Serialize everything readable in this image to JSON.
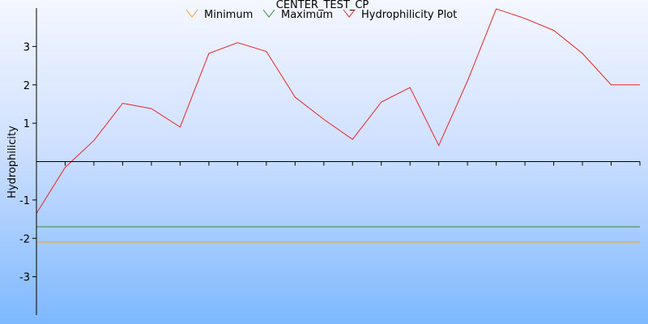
{
  "chart_data": {
    "type": "line",
    "title": "CENTER_TEST_CP",
    "xlabel": "",
    "ylabel": "Hydrophilicity",
    "ylim": [
      -4,
      4
    ],
    "yticks": [
      -3,
      -2,
      -1,
      1,
      2,
      3
    ],
    "x": [
      1,
      2,
      3,
      4,
      5,
      6,
      7,
      8,
      9,
      10,
      11,
      12,
      13,
      14,
      15,
      16,
      17,
      18,
      19,
      20,
      21,
      22
    ],
    "xlim": [
      1,
      22
    ],
    "grid": false,
    "legend_position": "top",
    "series": [
      {
        "name": "Minimum",
        "color": "#f0a030",
        "values": [
          -2.1,
          -2.1,
          -2.1,
          -2.1,
          -2.1,
          -2.1,
          -2.1,
          -2.1,
          -2.1,
          -2.1,
          -2.1,
          -2.1,
          -2.1,
          -2.1,
          -2.1,
          -2.1,
          -2.1,
          -2.1,
          -2.1,
          -2.1,
          -2.1,
          -2.1
        ]
      },
      {
        "name": "Maximum",
        "color": "#2e8b3a",
        "values": [
          -1.7,
          -1.7,
          -1.7,
          -1.7,
          -1.7,
          -1.7,
          -1.7,
          -1.7,
          -1.7,
          -1.7,
          -1.7,
          -1.7,
          -1.7,
          -1.7,
          -1.7,
          -1.7,
          -1.7,
          -1.7,
          -1.7,
          -1.7,
          -1.7,
          -1.7
        ]
      },
      {
        "name": "Hydrophilicity Plot",
        "color": "#e8232b",
        "values": [
          -1.35,
          -0.15,
          0.55,
          1.52,
          1.38,
          0.9,
          2.82,
          3.1,
          2.87,
          1.68,
          1.1,
          0.58,
          1.55,
          1.93,
          0.42,
          2.1,
          3.98,
          3.73,
          3.42,
          2.82,
          2.0,
          2.0
        ]
      }
    ]
  }
}
